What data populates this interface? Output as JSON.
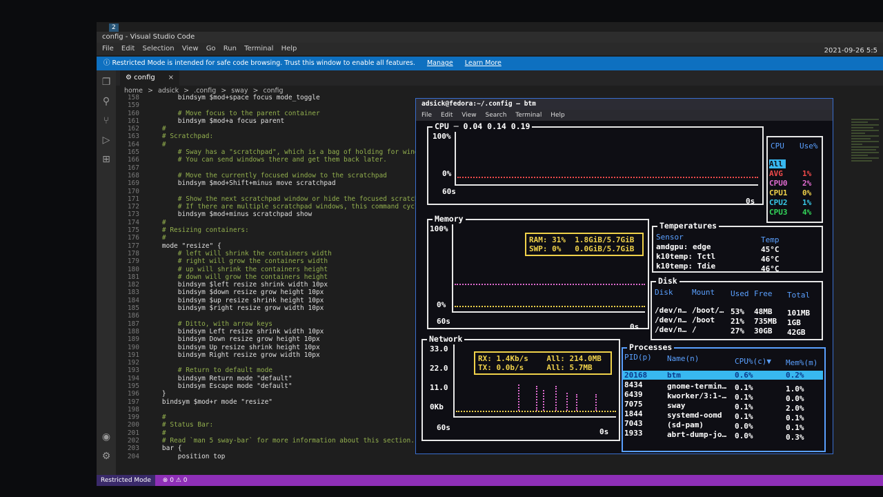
{
  "vscode": {
    "workspace_number": "2",
    "title": "config - Visual Studio Code",
    "menu": [
      "File",
      "Edit",
      "Selection",
      "View",
      "Go",
      "Run",
      "Terminal",
      "Help"
    ],
    "clock": "2021-09-26  5:5",
    "banner": {
      "text": "Restricted Mode is intended for safe code browsing. Trust this window to enable all features.",
      "manage": "Manage",
      "learn_more": "Learn More"
    },
    "tab_label": "config",
    "tab_close": "×",
    "breadcrumb": [
      "home",
      ">",
      "adsick",
      ">",
      ".config",
      ">",
      "sway",
      ">",
      "config"
    ],
    "statusbar": {
      "mode": "Restricted Mode",
      "problems": "⊗ 0 ⚠ 0"
    },
    "code_lines": [
      {
        "n": "158",
        "t": "        bindsym $mod+space focus mode_toggle",
        "c": "kw"
      },
      {
        "n": "159",
        "t": "",
        "c": "kw"
      },
      {
        "n": "160",
        "t": "        # Move focus to the parent container",
        "c": "cm"
      },
      {
        "n": "161",
        "t": "        bindsym $mod+a focus parent",
        "c": "kw"
      },
      {
        "n": "162",
        "t": "    #",
        "c": "cm"
      },
      {
        "n": "163",
        "t": "    # Scratchpad:",
        "c": "cm"
      },
      {
        "n": "164",
        "t": "    #",
        "c": "cm"
      },
      {
        "n": "165",
        "t": "        # Sway has a \"scratchpad\", which is a bag of holding for windows.",
        "c": "cm"
      },
      {
        "n": "166",
        "t": "        # You can send windows there and get them back later.",
        "c": "cm"
      },
      {
        "n": "167",
        "t": "",
        "c": "kw"
      },
      {
        "n": "168",
        "t": "        # Move the currently focused window to the scratchpad",
        "c": "cm"
      },
      {
        "n": "169",
        "t": "        bindsym $mod+Shift+minus move scratchpad",
        "c": "kw"
      },
      {
        "n": "170",
        "t": "",
        "c": "kw"
      },
      {
        "n": "171",
        "t": "        # Show the next scratchpad window or hide the focused scratchpad window.",
        "c": "cm"
      },
      {
        "n": "172",
        "t": "        # If there are multiple scratchpad windows, this command cycles through them.",
        "c": "cm"
      },
      {
        "n": "173",
        "t": "        bindsym $mod+minus scratchpad show",
        "c": "kw"
      },
      {
        "n": "174",
        "t": "    #",
        "c": "cm"
      },
      {
        "n": "175",
        "t": "    # Resizing containers:",
        "c": "cm"
      },
      {
        "n": "176",
        "t": "    #",
        "c": "cm"
      },
      {
        "n": "177",
        "t": "    mode \"resize\" {",
        "c": "kw"
      },
      {
        "n": "178",
        "t": "        # left will shrink the containers width",
        "c": "cm"
      },
      {
        "n": "179",
        "t": "        # right will grow the containers width",
        "c": "cm"
      },
      {
        "n": "180",
        "t": "        # up will shrink the containers height",
        "c": "cm"
      },
      {
        "n": "181",
        "t": "        # down will grow the containers height",
        "c": "cm"
      },
      {
        "n": "182",
        "t": "        bindsym $left resize shrink width 10px",
        "c": "kw"
      },
      {
        "n": "183",
        "t": "        bindsym $down resize grow height 10px",
        "c": "kw"
      },
      {
        "n": "184",
        "t": "        bindsym $up resize shrink height 10px",
        "c": "kw"
      },
      {
        "n": "185",
        "t": "        bindsym $right resize grow width 10px",
        "c": "kw"
      },
      {
        "n": "186",
        "t": "",
        "c": "kw"
      },
      {
        "n": "187",
        "t": "        # Ditto, with arrow keys",
        "c": "cm"
      },
      {
        "n": "188",
        "t": "        bindsym Left resize shrink width 10px",
        "c": "kw"
      },
      {
        "n": "189",
        "t": "        bindsym Down resize grow height 10px",
        "c": "kw"
      },
      {
        "n": "190",
        "t": "        bindsym Up resize shrink height 10px",
        "c": "kw"
      },
      {
        "n": "191",
        "t": "        bindsym Right resize grow width 10px",
        "c": "kw"
      },
      {
        "n": "192",
        "t": "",
        "c": "kw"
      },
      {
        "n": "193",
        "t": "        # Return to default mode",
        "c": "cm"
      },
      {
        "n": "194",
        "t": "        bindsym Return mode \"default\"",
        "c": "kw"
      },
      {
        "n": "195",
        "t": "        bindsym Escape mode \"default\"",
        "c": "kw"
      },
      {
        "n": "196",
        "t": "    }",
        "c": "kw"
      },
      {
        "n": "197",
        "t": "    bindsym $mod+r mode \"resize\"",
        "c": "kw"
      },
      {
        "n": "198",
        "t": "",
        "c": "kw"
      },
      {
        "n": "199",
        "t": "    #",
        "c": "cm"
      },
      {
        "n": "200",
        "t": "    # Status Bar:",
        "c": "cm"
      },
      {
        "n": "201",
        "t": "    #",
        "c": "cm"
      },
      {
        "n": "202",
        "t": "    # Read `man 5 sway-bar` for more information about this section.",
        "c": "cm"
      },
      {
        "n": "203",
        "t": "    bar {",
        "c": "kw"
      },
      {
        "n": "204",
        "t": "        position top",
        "c": "kw"
      }
    ]
  },
  "terminal": {
    "title": "adsick@fedora:~/.config — btm",
    "menu": [
      "File",
      "Edit",
      "View",
      "Search",
      "Terminal",
      "Help"
    ],
    "cpu": {
      "title": "CPU ─ 0.04 0.14 0.19",
      "y_top": "100%",
      "y_bottom": "0%",
      "x_left": "60s",
      "x_right": "0s",
      "legend_header_name": "CPU",
      "legend_header_use": "Use%",
      "rows": [
        {
          "name": "All",
          "use": ""
        },
        {
          "name": "AVG",
          "use": "1%"
        },
        {
          "name": "CPU0",
          "use": "2%"
        },
        {
          "name": "CPU1",
          "use": "0%"
        },
        {
          "name": "CPU2",
          "use": "1%"
        },
        {
          "name": "CPU3",
          "use": "4%"
        }
      ]
    },
    "memory": {
      "title": "Memory",
      "y_top": "100%",
      "y_bottom": "0%",
      "x_left": "60s",
      "x_right": "0s",
      "ram_label": "RAM:",
      "ram_pct": "31%",
      "ram_val": "1.8GiB/5.7GiB",
      "swp_label": "SWP:",
      "swp_pct": "0%",
      "swp_val": "0.0GiB/5.7GiB"
    },
    "temperatures": {
      "title": "Temperatures",
      "h_sensor": "Sensor",
      "h_temp": "Temp",
      "rows": [
        {
          "sensor": "amdgpu: edge",
          "temp": "45°C"
        },
        {
          "sensor": "k10temp: Tctl",
          "temp": "46°C"
        },
        {
          "sensor": "k10temp: Tdie",
          "temp": "46°C"
        }
      ]
    },
    "disk": {
      "title": "Disk",
      "headers": [
        "Disk",
        "Mount",
        "Used",
        "Free",
        "Total"
      ],
      "rows": [
        {
          "disk": "/dev/n…",
          "mount": "/boot/…",
          "used": "53%",
          "free": "48MB",
          "total": "101MB"
        },
        {
          "disk": "/dev/n…",
          "mount": "/boot",
          "used": "21%",
          "free": "735MB",
          "total": "1GB"
        },
        {
          "disk": "/dev/n…",
          "mount": "/",
          "used": "27%",
          "free": "30GB",
          "total": "42GB"
        }
      ]
    },
    "network": {
      "title": "Network",
      "y_ticks": [
        "33.0",
        "22.0",
        "11.0",
        "0Kb"
      ],
      "x_left": "60s",
      "x_right": "0s",
      "rx": "RX: 1.4Kb/s",
      "tx": "TX: 0.0b/s",
      "all_rx": "All: 214.0MB",
      "all_tx": "All: 5.7MB"
    },
    "processes": {
      "title": "Processes",
      "h_pid": "PID(p)",
      "h_name": "Name(n)",
      "h_cpu": "CPU%(c)▼",
      "h_mem": "Mem%(m)",
      "rows": [
        {
          "pid": "20168",
          "name": "btm",
          "cpu": "0.6%",
          "mem": "0.2%"
        },
        {
          "pid": "8434",
          "name": "gnome-termin…",
          "cpu": "0.1%",
          "mem": "1.0%"
        },
        {
          "pid": "6439",
          "name": "kworker/3:1-…",
          "cpu": "0.1%",
          "mem": "0.0%"
        },
        {
          "pid": "7075",
          "name": "sway",
          "cpu": "0.1%",
          "mem": "2.0%"
        },
        {
          "pid": "1844",
          "name": "systemd-oomd",
          "cpu": "0.1%",
          "mem": "0.1%"
        },
        {
          "pid": "7043",
          "name": "(sd-pam)",
          "cpu": "0.0%",
          "mem": "0.1%"
        },
        {
          "pid": "1933",
          "name": "abrt-dump-jo…",
          "cpu": "0.0%",
          "mem": "0.3%"
        }
      ]
    }
  },
  "colors": {
    "vscode_banner": "#0e70c0",
    "statusbar": "#8e2fb8",
    "accent_blue": "#5aa0ff",
    "highlight": "#38b8f0",
    "yellow": "#f0d24a",
    "pink": "#e06bd0",
    "red": "#f04a4a",
    "green": "#33d65a"
  }
}
